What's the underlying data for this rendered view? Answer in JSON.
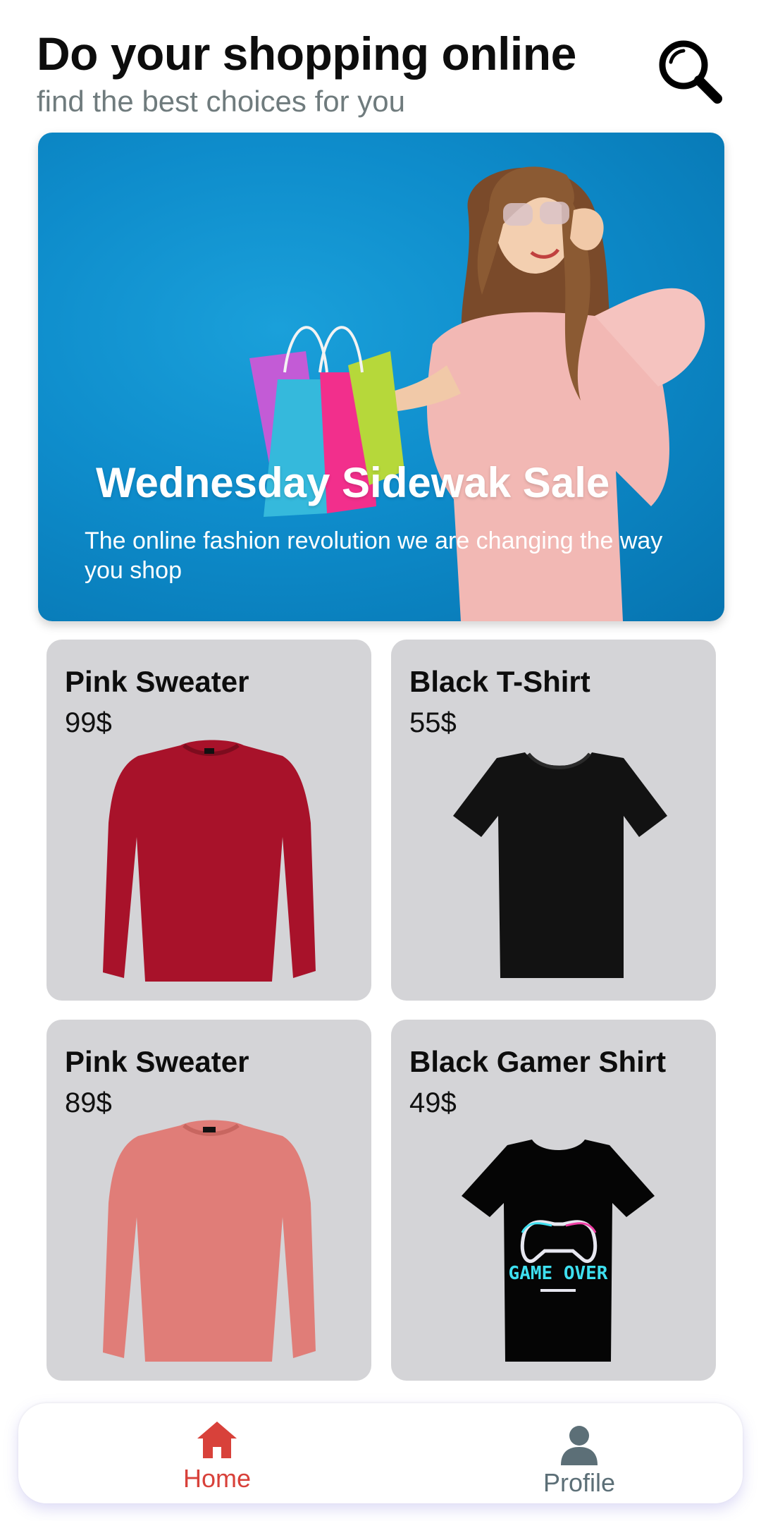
{
  "header": {
    "title": "Do your shopping online",
    "subtitle": "find the best choices for you",
    "search_icon": "search-icon"
  },
  "banner": {
    "title": "Wednesday Sidewak Sale",
    "description": "The online fashion revolution we are changing the way you shop",
    "background_color": "#0e8ccb"
  },
  "products": [
    {
      "name": "Pink Sweater",
      "price": "99$",
      "image": "red-sweater-image",
      "color": "#a8122a"
    },
    {
      "name": "Black T-Shirt",
      "price": "55$",
      "image": "black-tshirt-image",
      "color": "#111111"
    },
    {
      "name": "Pink Sweater",
      "price": "89$",
      "image": "pink-sweater-image",
      "color": "#e07d78"
    },
    {
      "name": "Black Gamer Shirt",
      "price": "49$",
      "image": "gamer-shirt-image",
      "color": "#050505"
    }
  ],
  "product_graphic_text": "GAME OVER",
  "nav": {
    "items": [
      {
        "label": "Home",
        "icon": "home-icon",
        "active": true,
        "color": "#d8413a"
      },
      {
        "label": "Profile",
        "icon": "profile-icon",
        "active": false,
        "color": "#5c6f77"
      }
    ]
  }
}
